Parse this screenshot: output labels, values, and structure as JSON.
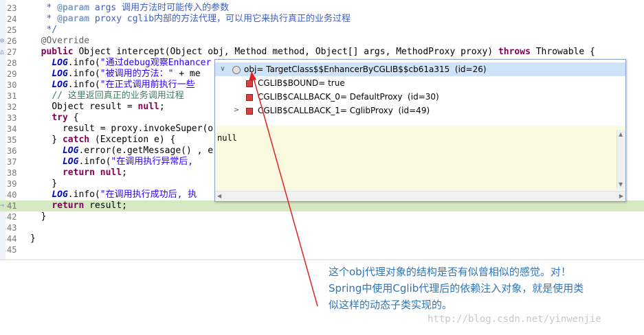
{
  "editor": {
    "lines": [
      {
        "num": "23",
        "html": "   <span class='jd'>* <span class='jdtag'>@param</span> args 调用方法时可能传入的参数</span>"
      },
      {
        "num": "24",
        "html": "   <span class='jd'>* <span class='jdtag'>@param</span> proxy cglib内部的方法代理，可以用它来执行真正的业务过程</span>"
      },
      {
        "num": "25",
        "html": "   <span class='jd'>*/</span>"
      },
      {
        "num": "26",
        "marker": "⊖",
        "html": "  <span class='an'>@Override</span>"
      },
      {
        "num": "27",
        "marker": "△",
        "html": "  <span class='kw'>public</span> Object intercept(Object obj, Method method, Object[] args, MethodProxy proxy) <span class='kw'>throws</span> Throwable {"
      },
      {
        "num": "28",
        "html": "    <span class='fd'>LOG</span>.info(<span class='st'>\"通过debug观察Enhancer</span>"
      },
      {
        "num": "29",
        "html": "    <span class='fd'>LOG</span>.info(<span class='st'>\"被调用的方法：\"</span> + me"
      },
      {
        "num": "30",
        "html": "    <span class='fd'>LOG</span>.info(<span class='st'>\"在正式调用前执行一些</span>"
      },
      {
        "num": "31",
        "html": "    <span class='cm'>// 这里返回真正的业务调用过程</span>"
      },
      {
        "num": "32",
        "html": "    Object result = <span class='kw'>null</span>;"
      },
      {
        "num": "33",
        "html": "    <span class='kw'>try</span> {"
      },
      {
        "num": "34",
        "html": "      result = proxy.invokeSuper(o"
      },
      {
        "num": "35",
        "html": "    } <span class='kw'>catch</span> (Exception e) {"
      },
      {
        "num": "36",
        "html": "      <span class='fd'>LOG</span>.error(e.getMessage() , e"
      },
      {
        "num": "37",
        "html": "      <span class='fd'>LOG</span>.info(<span class='st'>\"在调用执行异常后,</span>"
      },
      {
        "num": "38",
        "html": "      <span class='kw'>return null</span>;"
      },
      {
        "num": "39",
        "html": "    }"
      },
      {
        "num": "40",
        "html": "    <span class='fd'>LOG</span>.info(<span class='st'>\"在调用执行成功后, 执</span>"
      },
      {
        "num": "41",
        "marker": "⇒",
        "html": "    <span class='kw'>return</span> result;"
      },
      {
        "num": "42",
        "html": "  }"
      },
      {
        "num": "43",
        "html": ""
      },
      {
        "num": "44",
        "html": "}"
      },
      {
        "num": "45",
        "html": ""
      }
    ]
  },
  "hover": {
    "rows": [
      {
        "twisty": "∨",
        "icon": "object-icon",
        "label": "obj= TargetClass$$EnhancerByCGLIB$$cb61a315  (id=26)"
      },
      {
        "twisty": "",
        "icon": "field-icon",
        "label": "CGLIB$BOUND= true"
      },
      {
        "twisty": "",
        "icon": "field-icon",
        "label": "CGLIB$CALLBACK_0= DefaultProxy  (id=30)"
      },
      {
        "twisty": ">",
        "icon": "field-icon",
        "label": "CGLIB$CALLBACK_1= CglibProxy  (id=49)"
      }
    ],
    "detail_value": "null"
  },
  "annotation": {
    "caption": "这个obj代理对象的结构是否有似曾相似的感觉。对！Spring中使用Cglib代理后的依赖注入对象，就是使用类似这样的动态子类实现的。",
    "arrow_color": "#e02020"
  },
  "watermark": "http://blog.csdn.net/yinwenjie"
}
